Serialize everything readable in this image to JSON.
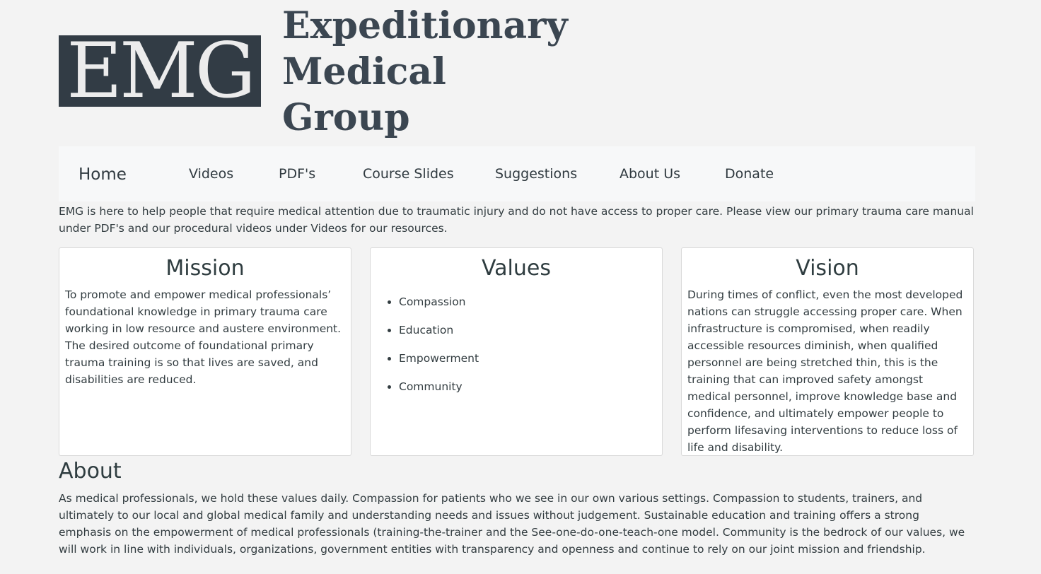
{
  "logo": {
    "mark": "EMG",
    "name_lines": [
      "Expeditionary",
      "Medical",
      "Group"
    ]
  },
  "nav": {
    "items": [
      {
        "label": "Home"
      },
      {
        "label": "Videos"
      },
      {
        "label": "PDF's"
      },
      {
        "label": "Course Slides"
      },
      {
        "label": "Suggestions"
      },
      {
        "label": "About Us"
      },
      {
        "label": "Donate"
      }
    ]
  },
  "intro": {
    "text": "EMG is here to help people that require medical attention due to traumatic injury and do not have access to proper care. Please view our primary trauma care manual under PDF's and our procedural videos under Videos for our resources."
  },
  "cards": {
    "mission": {
      "title": "Mission",
      "text": "To promote and empower medical professionals’ foundational knowledge in primary trauma care working in low resource and austere environment. The desired outcome of foundational primary trauma training is so that lives are saved, and disabilities are reduced."
    },
    "values": {
      "title": "Values",
      "items": [
        "Compassion",
        "Education",
        "Empowerment",
        "Community"
      ]
    },
    "vision": {
      "title": "Vision",
      "text": "During times of conflict, even the most developed nations can struggle accessing proper care. When infrastructure is compromised, when readily accessible resources diminish, when qualified personnel are being stretched thin, this is the training that can improved safety amongst medical personnel, improve knowledge base and confidence, and ultimately empower people to perform lifesaving interventions to reduce loss of life and disability."
    }
  },
  "about": {
    "title": "About",
    "text": "As medical professionals, we hold these values daily. Compassion for patients who we see in our own various settings. Compassion to students, trainers, and ultimately to our local and global medical family and understanding needs and issues without judgement. Sustainable education and training offers a strong emphasis on the empowerment of medical professionals (training-the-trainer and the See-one-do-one-teach-one model. Community is the bedrock of our values, we will work in line with individuals, organizations, government entities with transparency and openness and continue to rely on our joint mission and friendship."
  }
}
